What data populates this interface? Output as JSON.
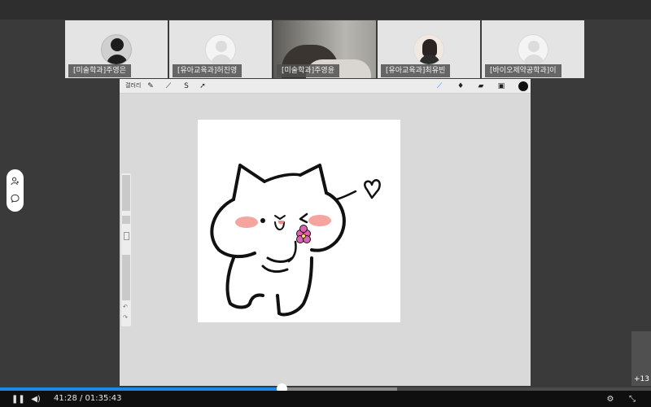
{
  "participants": [
    {
      "name": "[미술학과]주영은",
      "style": "photo-dark",
      "icon": "user-avatar"
    },
    {
      "name": "[유아교육과]허진영",
      "style": "placeholder",
      "icon": "user-avatar"
    },
    {
      "name": "[미술학과]주영윤",
      "style": "video",
      "icon": "webcam-video"
    },
    {
      "name": "[유아교육과]최유빈",
      "style": "photo-girl",
      "icon": "user-avatar"
    },
    {
      "name": "[바이오제약공학과]이",
      "style": "placeholder",
      "icon": "user-avatar"
    }
  ],
  "app": {
    "gallery_label": "갤러리",
    "brush_color": "#111111"
  },
  "player": {
    "time": "41:28 / 01:35:43",
    "played_fraction": 0.433,
    "buffered_fraction": 0.61,
    "more_count": "+13"
  },
  "colors": {
    "accent": "#1e88e5",
    "cheek": "#f4a5a0",
    "flower": "#e060b0"
  }
}
